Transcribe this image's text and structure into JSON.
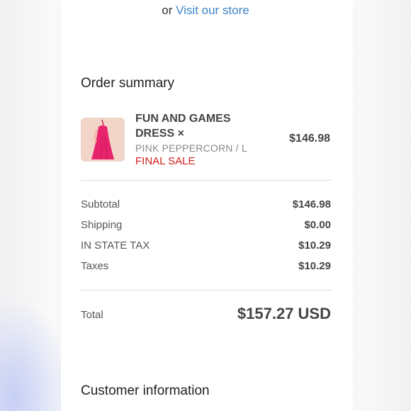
{
  "header": {
    "prefix": "or",
    "store_link": "Visit our store"
  },
  "order_summary": {
    "title": "Order summary",
    "item": {
      "name": "FUN AND GAMES DRESS ×",
      "variant": "PINK PEPPERCORN / L",
      "sale_label": "FINAL SALE",
      "price": "$146.98",
      "image_icon": "pink-dress-image"
    },
    "rows": [
      {
        "label": "Subtotal",
        "value": "$146.98"
      },
      {
        "label": "Shipping",
        "value": "$0.00"
      },
      {
        "label": "IN STATE TAX",
        "value": "$10.29"
      },
      {
        "label": "Taxes",
        "value": "$10.29"
      }
    ],
    "total": {
      "label": "Total",
      "value": "$157.27 USD"
    }
  },
  "customer_information": {
    "title": "Customer information"
  },
  "colors": {
    "link": "#3f86c8",
    "sale": "#d11b1b",
    "dress": "#e8236e"
  }
}
